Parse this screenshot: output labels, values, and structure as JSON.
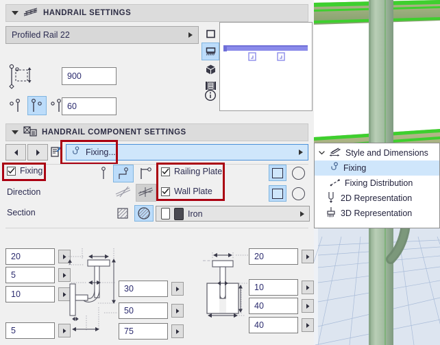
{
  "sections": {
    "handrail_settings": {
      "title": "HANDRAIL SETTINGS",
      "icon": "handrail-icon"
    },
    "component_settings": {
      "title": "HANDRAIL COMPONENT SETTINGS",
      "icon": "component-icon"
    }
  },
  "profile_selector": {
    "value": "Profiled Rail 22"
  },
  "fields": {
    "height": "900",
    "offset": "60"
  },
  "icon_strip": [
    {
      "name": "2d-view-icon",
      "selected": false
    },
    {
      "name": "section-view-icon",
      "selected": true
    },
    {
      "name": "3d-view-icon",
      "selected": false
    },
    {
      "name": "list-view-icon",
      "selected": false
    },
    {
      "name": "info-icon",
      "selected": false
    }
  ],
  "component_selector": {
    "value": "Fixing...",
    "icon": "fixing-icon"
  },
  "toolbar": {
    "back_label": "◀",
    "forward_label": "▶",
    "edit_label": "edit-component-icon"
  },
  "rows": {
    "fixing": {
      "label": "Fixing",
      "checked": true
    },
    "direction": {
      "label": "Direction"
    },
    "section": {
      "label": "Section"
    },
    "railing_plate": {
      "label": "Railing Plate",
      "checked": true
    },
    "wall_plate": {
      "label": "Wall Plate",
      "checked": true
    }
  },
  "material": {
    "value": "Iron"
  },
  "dimensions": {
    "left_column": [
      "20",
      "5",
      "10",
      "5"
    ],
    "middle_column": [
      "30",
      "50",
      "75"
    ],
    "right_column": [
      "20",
      "10",
      "40",
      "40"
    ]
  },
  "tree": {
    "items": [
      {
        "label": "Style and Dimensions",
        "icon": "style-dimensions-icon",
        "level": 0,
        "selected": false,
        "expanded": true
      },
      {
        "label": "Fixing",
        "icon": "fixing-icon",
        "level": 1,
        "selected": true
      },
      {
        "label": "Fixing Distribution",
        "icon": "fixing-distribution-icon",
        "level": 1,
        "selected": false
      },
      {
        "label": "2D Representation",
        "icon": "2d-representation-icon",
        "level": 1,
        "selected": false
      },
      {
        "label": "3D Representation",
        "icon": "3d-representation-icon",
        "level": 1,
        "selected": false
      }
    ]
  },
  "colors": {
    "accent": "#4a90d9",
    "annotation": "#aa0011",
    "selection": "#cfe6fb",
    "header": "#dcdcdc",
    "model_green": "#3ecf2e",
    "rail_preview": "#7b7bdd"
  }
}
